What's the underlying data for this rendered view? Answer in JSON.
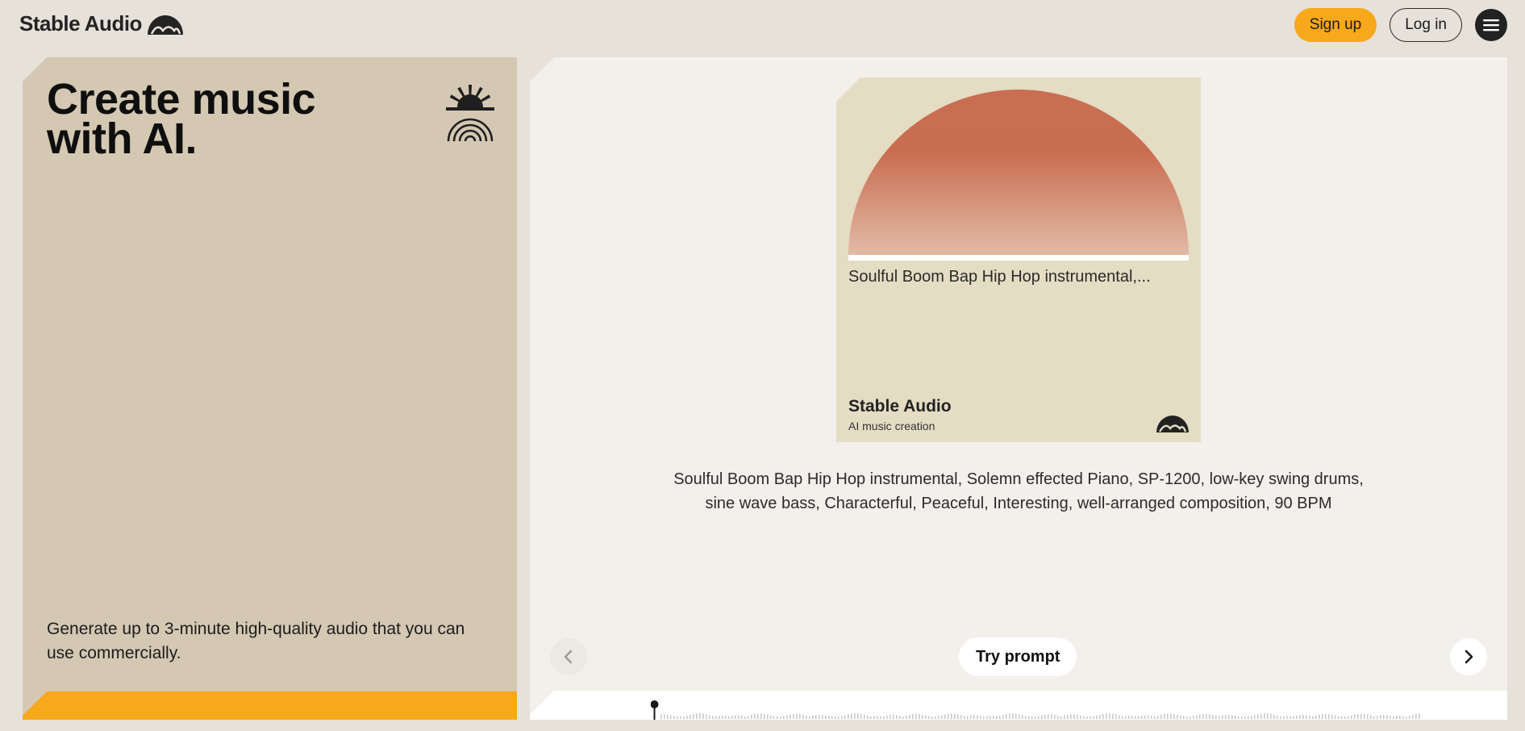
{
  "header": {
    "brand": "Stable Audio",
    "signup_label": "Sign up",
    "login_label": "Log in",
    "menu_icon": "hamburger-menu-icon"
  },
  "hero": {
    "title_line1": "Create music",
    "title_line2": "with AI.",
    "subtitle": "Generate up to 3-minute high-quality audio that you can use commercially.",
    "emblem_icon": "sunrise-emblem-icon"
  },
  "showcase": {
    "album_title": "Soulful Boom Bap Hip Hop instrumental,...",
    "album_brand": "Stable Audio",
    "album_tagline": "AI music creation",
    "prompt": "Soulful Boom Bap Hip Hop instrumental, Solemn effected Piano, SP-1200, low-key swing drums, sine wave bass, Characterful, Peaceful, Interesting, well-arranged composition, 90 BPM",
    "try_label": "Try prompt",
    "prev_icon": "chevron-left-icon",
    "next_icon": "chevron-right-icon"
  },
  "colors": {
    "accent": "#f7a81b",
    "page_bg": "#e6e1d9",
    "left_panel": "#d4c8b3",
    "right_panel": "#f3f0eb",
    "album_bg": "#e4dcc3",
    "sun_top": "#c96e52",
    "sun_bottom": "#dfb6a0"
  }
}
